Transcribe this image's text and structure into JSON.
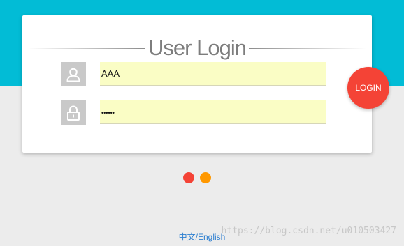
{
  "login": {
    "title": "User Login",
    "username_value": "AAA",
    "password_value": "••••••",
    "button_label": "LOGIN"
  },
  "colors": {
    "header": "#02bcd6",
    "background": "#ececec",
    "card": "#ffffff",
    "input_bg": "#fafdc5",
    "login_button": "#f44336",
    "dot_red": "#f44336",
    "dot_orange": "#ff9800",
    "link": "#2d7fd0"
  },
  "icons": {
    "username": "user-icon",
    "password": "lock-icon"
  },
  "loader": {
    "dots": [
      "red",
      "orange"
    ]
  },
  "language": {
    "chinese": "中文/",
    "english": "English"
  },
  "watermark": "https://blog.csdn.net/u010503427"
}
